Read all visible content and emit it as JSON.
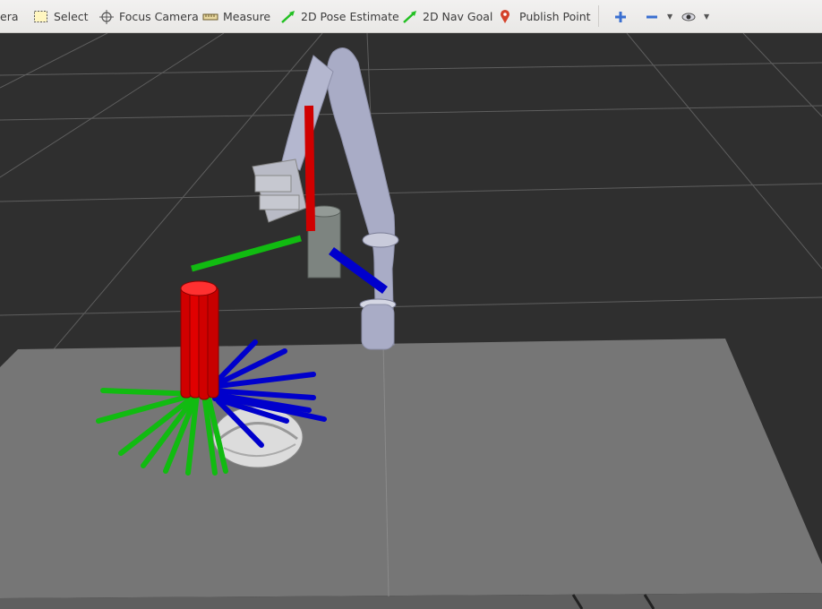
{
  "toolbar": {
    "interact_partial": "era",
    "select": "Select",
    "focus_camera": "Focus Camera",
    "measure": "Measure",
    "pose_estimate": "2D Pose Estimate",
    "nav_goal": "2D Nav Goal",
    "publish_point": "Publish Point"
  },
  "icons": {
    "select": "select-rectangle-icon",
    "focus_camera": "crosshair-icon",
    "measure": "ruler-icon",
    "pose_estimate": "green-arrow-icon",
    "nav_goal": "green-arrow-icon",
    "publish_point": "map-pin-icon",
    "add": "plus-icon",
    "remove": "minus-icon",
    "view": "eye-icon"
  },
  "colors": {
    "background": "#2f2f2f",
    "grid": "#5a5a5a",
    "table": "#767676",
    "axis_x": "#d00000",
    "axis_y": "#11bb11",
    "axis_z": "#0000cc",
    "robot": "#a9acc6"
  }
}
